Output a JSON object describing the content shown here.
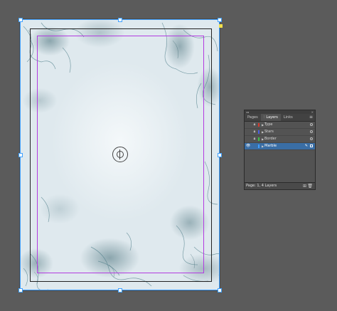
{
  "panel": {
    "tabs": [
      {
        "label": "Pages"
      },
      {
        "label": "Layers"
      },
      {
        "label": "Links"
      }
    ],
    "menu_icon": "hamburger-icon",
    "layers": [
      {
        "name": "Type",
        "color": "#d43a2f",
        "visible": false,
        "locked": true,
        "selected": false
      },
      {
        "name": "Stars",
        "color": "#4a5ee0",
        "visible": false,
        "locked": true,
        "selected": false
      },
      {
        "name": "Border",
        "color": "#3fbf4a",
        "visible": false,
        "locked": true,
        "selected": false
      },
      {
        "name": "Marble",
        "color": "#3fa0ff",
        "visible": true,
        "locked": false,
        "selected": true
      }
    ],
    "status": "Page: 1, 4 Layers"
  },
  "colors": {
    "workspace": "#5b5b5b",
    "selection": "#3fa0ff",
    "margin": "#b23be0",
    "panel_bg": "#535353",
    "selected_row": "#3a6ea5"
  }
}
